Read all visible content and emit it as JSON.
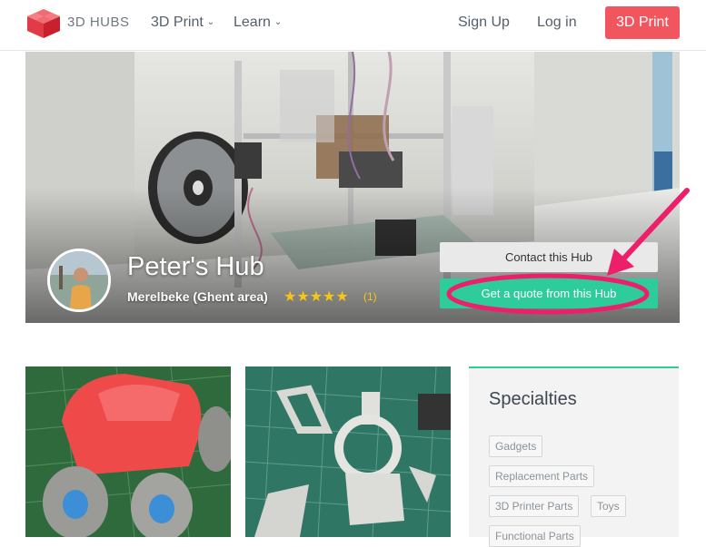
{
  "header": {
    "brand": "3D HUBS",
    "nav": [
      {
        "label": "3D Print"
      },
      {
        "label": "Learn"
      }
    ],
    "signup": "Sign Up",
    "login": "Log in",
    "cta": "3D Print"
  },
  "hub": {
    "name": "Peter's Hub",
    "location": "Merelbeke (Ghent area)",
    "stars": "★★★★★",
    "rating": 5,
    "reviews": "(1)",
    "contact_button": "Contact this Hub",
    "quote_button": "Get a quote from this Hub"
  },
  "specialties": {
    "title": "Specialties",
    "tags": [
      "Gadgets",
      "Replacement Parts",
      "3D Printer Parts",
      "Toys",
      "Functional Parts"
    ]
  },
  "colors": {
    "brand_red": "#f1565f",
    "accent_green": "#2ecc9b",
    "annotation_pink": "#ee1f6a",
    "star_yellow": "#f5c518"
  }
}
